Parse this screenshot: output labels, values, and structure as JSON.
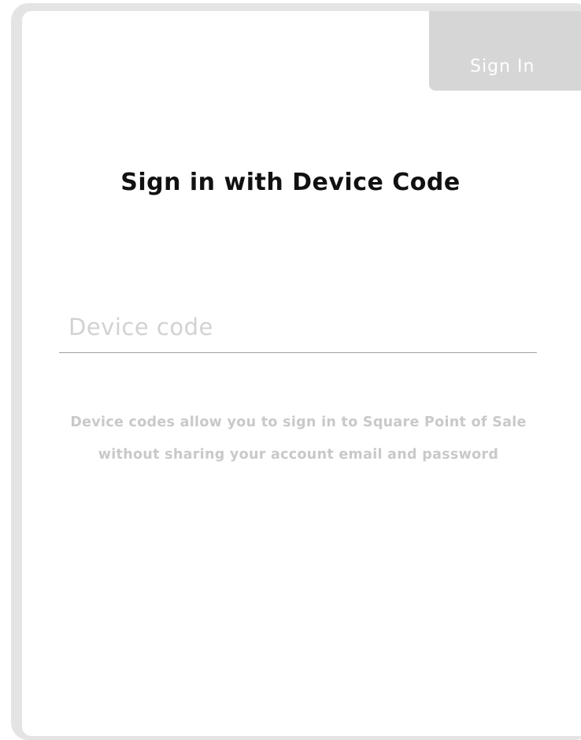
{
  "header": {
    "sign_in_label": "Sign In"
  },
  "main": {
    "title": "Sign in with Device Code",
    "device_code": {
      "value": "",
      "placeholder": "Device code"
    },
    "helper_text": "Device codes allow you to sign in to Square Point of Sale without sharing your account email and password"
  },
  "colors": {
    "frame": "#e4e4e4",
    "sign_in_button_bg": "#d6d6d6",
    "title_text": "#111111",
    "placeholder_text": "#d2d2d2",
    "helper_text": "#c9c9c9"
  }
}
